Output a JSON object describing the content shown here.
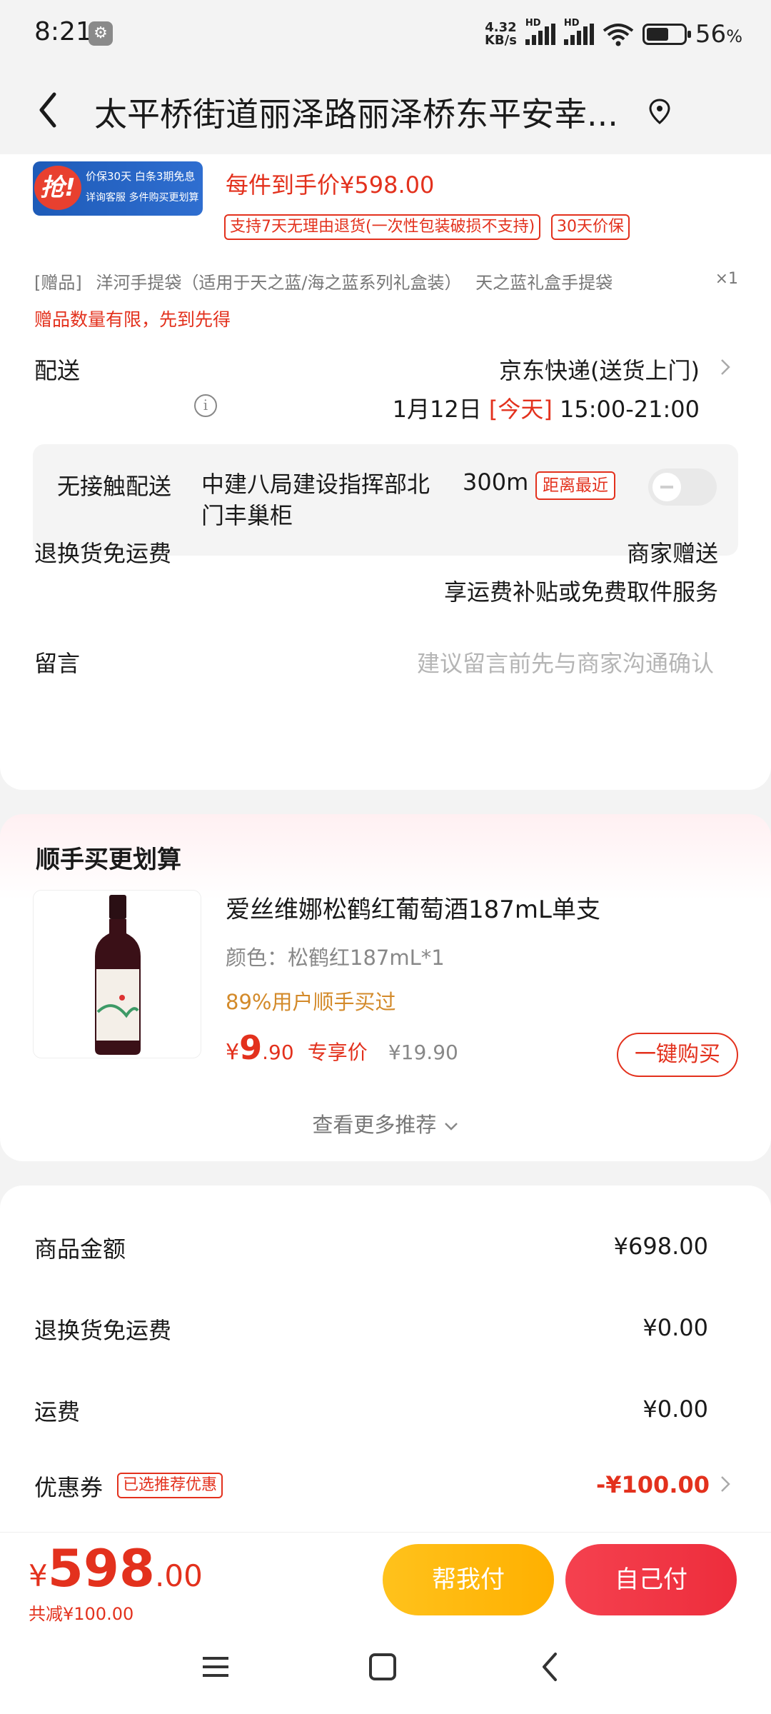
{
  "status_bar": {
    "time": "8:21",
    "net_speed": "4.32",
    "net_unit": "KB/s",
    "hd1": "HD",
    "hd2": "HD",
    "battery": "56",
    "battery_unit": "%"
  },
  "header": {
    "title": "太平桥街道丽泽路丽泽桥东平安幸..."
  },
  "product": {
    "promo_badge": "抢!",
    "promo_line1": "价保30天 白条3期免息",
    "promo_line2": "详询客服 多件购买更划算",
    "unit_price": "每件到手价¥598.00",
    "tag_return": "支持7天无理由退货(一次性包装破损不支持)",
    "tag_price_protect": "30天价保"
  },
  "gift": {
    "prefix": "[赠品]",
    "item1": "洋河手提袋（适用于天之蓝/海之蓝系列礼盒装）",
    "item2": "天之蓝礼盒手提袋",
    "qty": "×1",
    "limit_note": "赠品数量有限，先到先得"
  },
  "delivery": {
    "label": "配送",
    "method": "京东快递(送货上门)",
    "date": "1月12日",
    "today": "[今天]",
    "time_window": "15:00-21:00"
  },
  "contactless": {
    "label": "无接触配送",
    "location": "中建八局建设指挥部北门丰巢柜",
    "distance": "300m",
    "nearest_tag": "距离最近",
    "enabled": false
  },
  "return_shipping": {
    "label": "退换货免运费",
    "value": "商家赠送",
    "desc": "享运费补贴或免费取件服务"
  },
  "message": {
    "label": "留言",
    "placeholder": "建议留言前先与商家沟通确认"
  },
  "recommend": {
    "title": "顺手买更划算",
    "name": "爱丝维娜松鹤红葡萄酒187mL单支",
    "spec": "颜色：松鹤红187mL*1",
    "bought": "89%用户顺手买过",
    "price_symbol": "¥",
    "price_int": "9",
    "price_dec": ".90",
    "exclusive": "专享价",
    "original_price": "¥19.90",
    "buy_button": "一键购买",
    "more": "查看更多推荐"
  },
  "summary": {
    "goods_label": "商品金额",
    "goods_value": "¥698.00",
    "return_label": "退换货免运费",
    "return_value": "¥0.00",
    "freight_label": "运费",
    "freight_value": "¥0.00",
    "coupon_label": "优惠券",
    "coupon_tag": "已选推荐优惠",
    "coupon_value": "-¥100.00"
  },
  "footer": {
    "currency": "¥",
    "total_int": "598",
    "total_dec": ".00",
    "saved": "共减¥100.00",
    "help_pay": "帮我付",
    "self_pay": "自己付"
  },
  "colors": {
    "accent_red": "#e3311d",
    "pay_red": "#ed2d3c",
    "help_yellow": "#ffb000",
    "bought_orange": "#d38a2a"
  }
}
